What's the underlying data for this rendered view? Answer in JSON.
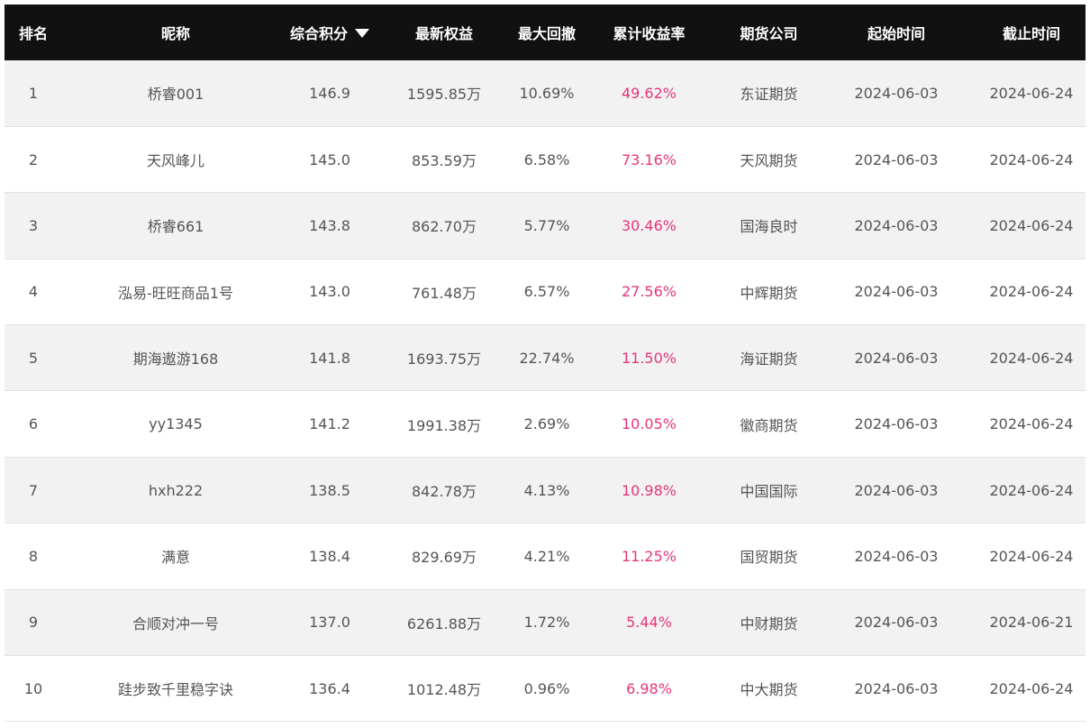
{
  "table": {
    "headers": {
      "rank": "排名",
      "nickname": "昵称",
      "score": "综合积分",
      "equity": "最新权益",
      "drawdown": "最大回撤",
      "return": "累计收益率",
      "company": "期货公司",
      "start": "起始时间",
      "end": "截止时间"
    },
    "sort": {
      "column": "score",
      "direction": "descending",
      "icon": "sort-descending-icon"
    },
    "colors": {
      "header_bg": "#111111",
      "header_text": "#ffffff",
      "return_text": "#e8357a",
      "row_alt": "#f2f2f3"
    },
    "rows": [
      {
        "rank": "1",
        "nickname": "桥睿001",
        "score": "146.9",
        "equity": "1595.85万",
        "drawdown": "10.69%",
        "return": "49.62%",
        "company": "东证期货",
        "start": "2024-06-03",
        "end": "2024-06-24"
      },
      {
        "rank": "2",
        "nickname": "天风峰儿",
        "score": "145.0",
        "equity": "853.59万",
        "drawdown": "6.58%",
        "return": "73.16%",
        "company": "天风期货",
        "start": "2024-06-03",
        "end": "2024-06-24"
      },
      {
        "rank": "3",
        "nickname": "桥睿661",
        "score": "143.8",
        "equity": "862.70万",
        "drawdown": "5.77%",
        "return": "30.46%",
        "company": "国海良时",
        "start": "2024-06-03",
        "end": "2024-06-24"
      },
      {
        "rank": "4",
        "nickname": "泓易-旺旺商品1号",
        "score": "143.0",
        "equity": "761.48万",
        "drawdown": "6.57%",
        "return": "27.56%",
        "company": "中辉期货",
        "start": "2024-06-03",
        "end": "2024-06-24"
      },
      {
        "rank": "5",
        "nickname": "期海遨游168",
        "score": "141.8",
        "equity": "1693.75万",
        "drawdown": "22.74%",
        "return": "11.50%",
        "company": "海证期货",
        "start": "2024-06-03",
        "end": "2024-06-24"
      },
      {
        "rank": "6",
        "nickname": "yy1345",
        "score": "141.2",
        "equity": "1991.38万",
        "drawdown": "2.69%",
        "return": "10.05%",
        "company": "徽商期货",
        "start": "2024-06-03",
        "end": "2024-06-24"
      },
      {
        "rank": "7",
        "nickname": "hxh222",
        "score": "138.5",
        "equity": "842.78万",
        "drawdown": "4.13%",
        "return": "10.98%",
        "company": "中国国际",
        "start": "2024-06-03",
        "end": "2024-06-24"
      },
      {
        "rank": "8",
        "nickname": "满意",
        "score": "138.4",
        "equity": "829.69万",
        "drawdown": "4.21%",
        "return": "11.25%",
        "company": "国贸期货",
        "start": "2024-06-03",
        "end": "2024-06-24"
      },
      {
        "rank": "9",
        "nickname": "合顺对冲一号",
        "score": "137.0",
        "equity": "6261.88万",
        "drawdown": "1.72%",
        "return": "5.44%",
        "company": "中财期货",
        "start": "2024-06-03",
        "end": "2024-06-21"
      },
      {
        "rank": "10",
        "nickname": "跬步致千里稳字诀",
        "score": "136.4",
        "equity": "1012.48万",
        "drawdown": "0.96%",
        "return": "6.98%",
        "company": "中大期货",
        "start": "2024-06-03",
        "end": "2024-06-24"
      }
    ]
  }
}
